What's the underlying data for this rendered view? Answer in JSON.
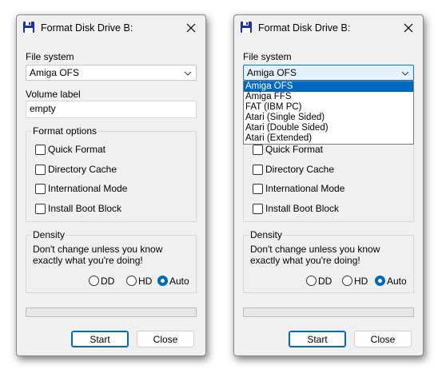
{
  "colors": {
    "accent": "#0067c0",
    "window_bg": "#f0f0f0",
    "selection": "#0067c0"
  },
  "windows": [
    {
      "title": "Format Disk Drive B:",
      "file_system_label": "File system",
      "file_system_value": "Amiga OFS",
      "volume_label_label": "Volume label",
      "volume_label_value": "empty",
      "format_options_title": "Format options",
      "options": [
        {
          "label": "Quick Format",
          "checked": false
        },
        {
          "label": "Directory Cache",
          "checked": false
        },
        {
          "label": "International Mode",
          "checked": false
        },
        {
          "label": "Install Boot Block",
          "checked": false
        }
      ],
      "density_title": "Density",
      "density_warning": "Don't change unless you know exactly what you're doing!",
      "density_options": [
        {
          "label": "DD",
          "selected": false
        },
        {
          "label": "HD",
          "selected": false
        },
        {
          "label": "Auto",
          "selected": true
        }
      ],
      "progress": 0,
      "start_label": "Start",
      "close_label": "Close"
    },
    {
      "title": "Format Disk Drive B:",
      "file_system_label": "File system",
      "file_system_value": "Amiga OFS",
      "dropdown_open": true,
      "dropdown_options": [
        "Amiga OFS",
        "Amiga FFS",
        "FAT (IBM PC)",
        "Atari (Single Sided)",
        "Atari (Double Sided)",
        "Atari (Extended)"
      ],
      "dropdown_selected_index": 0,
      "options": [
        {
          "label": "Quick Format",
          "checked": false
        },
        {
          "label": "Directory Cache",
          "checked": false
        },
        {
          "label": "International Mode",
          "checked": false
        },
        {
          "label": "Install Boot Block",
          "checked": false
        }
      ],
      "density_title": "Density",
      "density_warning": "Don't change unless you know exactly what you're doing!",
      "density_options": [
        {
          "label": "DD",
          "selected": false
        },
        {
          "label": "HD",
          "selected": false
        },
        {
          "label": "Auto",
          "selected": true
        }
      ],
      "progress": 0,
      "start_label": "Start",
      "close_label": "Close"
    }
  ]
}
